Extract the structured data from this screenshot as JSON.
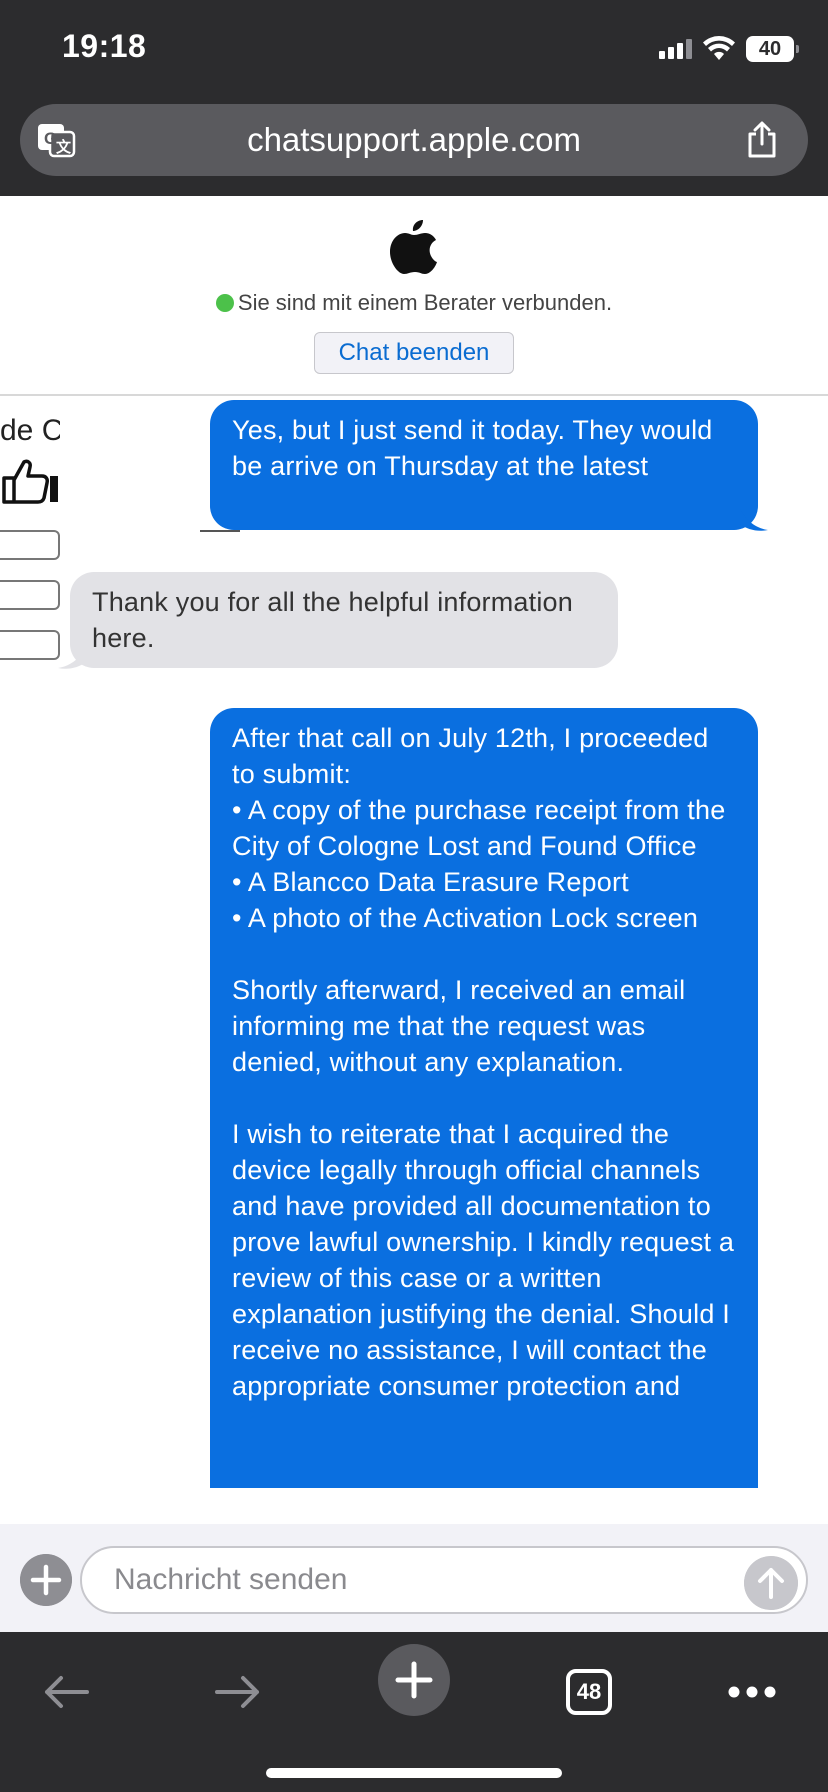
{
  "status_bar": {
    "time": "19:18",
    "battery": "40",
    "icons": [
      "cellular-signal-icon",
      "wifi-icon",
      "battery-icon"
    ]
  },
  "browser": {
    "url": "chatsupport.apple.com",
    "translate_icon": "translate-icon",
    "share_icon": "share-icon",
    "tabs_count": "48"
  },
  "chat_header": {
    "logo": "apple-logo",
    "status_text": "Sie sind mit einem Berater verbunden.",
    "end_chat_label": "Chat beenden"
  },
  "left_fragment": {
    "text": "de C"
  },
  "messages": [
    {
      "direction": "outgoing",
      "paragraphs": [
        "Yes, but I just send it today. They would be arrive on Thursday at the latest"
      ]
    },
    {
      "direction": "incoming",
      "paragraphs": [
        "Thank you for all the helpful information here."
      ]
    },
    {
      "direction": "outgoing",
      "paragraphs": [
        "After that call on July 12th, I proceeded to submit:",
        "• A copy of the purchase receipt from the City of Cologne Lost and Found Office",
        "• A Blancco Data Erasure Report",
        "• A photo of the Activation Lock screen",
        "Shortly afterward, I received an email informing me that the request was denied, without any explanation.",
        "I wish to reiterate that I acquired the device legally through official channels and have provided all documentation to prove lawful ownership. I kindly request a review of this case or a written explanation justifying the denial. Should I receive no assistance, I will contact the appropriate consumer protection and"
      ]
    }
  ],
  "composer": {
    "placeholder": "Nachricht senden"
  },
  "colors": {
    "outgoing_bubble": "#0a6fe0",
    "incoming_bubble": "#e2e2e6",
    "chrome": "#2c2c2e",
    "status_dot": "#4cc14a",
    "link": "#0a6cd1"
  }
}
